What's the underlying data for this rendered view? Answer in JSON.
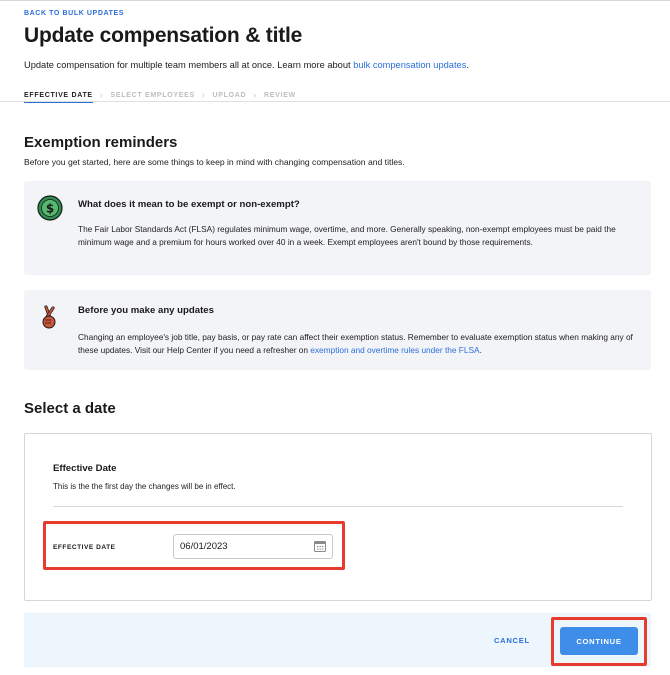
{
  "header": {
    "back_link": "BACK TO BULK UPDATES",
    "title": "Update compensation & title",
    "description_prefix": "Update compensation for multiple team members all at once. Learn more about ",
    "description_link": "bulk compensation updates",
    "description_suffix": "."
  },
  "steps": [
    {
      "label": "EFFECTIVE DATE",
      "active": true
    },
    {
      "label": "SELECT EMPLOYEES",
      "active": false
    },
    {
      "label": "UPLOAD",
      "active": false
    },
    {
      "label": "REVIEW",
      "active": false
    }
  ],
  "reminders": {
    "title": "Exemption reminders",
    "subtitle": "Before you get started, here are some things to keep in mind with changing compensation and titles.",
    "cards": [
      {
        "icon": "dollar-coin-icon",
        "title": "What does it mean to be exempt or non-exempt?",
        "body": "The Fair Labor Standards Act (FLSA) regulates minimum wage, overtime, and more. Generally speaking, non-exempt employees must be paid the minimum wage and a premium for hours worked over 40 in a week. Exempt employees aren't bound by those requirements."
      },
      {
        "icon": "crossed-fingers-icon",
        "title": "Before you make any updates",
        "body": "Changing an employee's job title, pay basis, or pay rate can affect their exemption status. Remember to evaluate exemption status when making any of these updates. Visit our Help Center if you need a refresher on ",
        "link": "exemption and overtime rules under the FLSA",
        "body_suffix": "."
      }
    ]
  },
  "date_section": {
    "title": "Select a date",
    "panel_title": "Effective Date",
    "panel_subtitle": "This is the the first day the changes will be in effect.",
    "field_label": "EFFECTIVE DATE",
    "field_value": "06/01/2023",
    "field_icon": "calendar-icon"
  },
  "footer": {
    "cancel_label": "CANCEL",
    "continue_label": "CONTINUE"
  },
  "colors": {
    "accent": "#2c6fdb",
    "button": "#3e8ee9",
    "highlight": "#e63b2e",
    "card_bg": "#f3f4f8",
    "footer_bg": "#eef6fd"
  }
}
